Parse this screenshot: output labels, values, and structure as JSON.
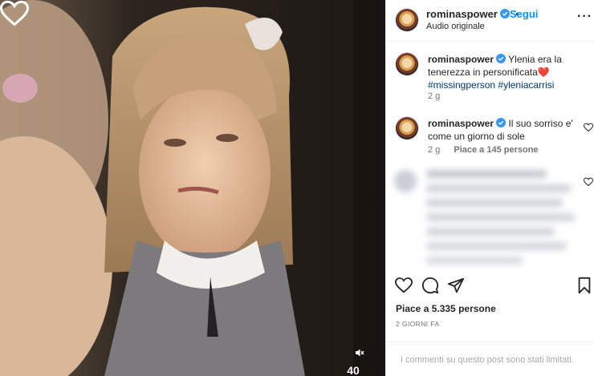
{
  "media": {
    "reel_like_count": "40",
    "heart_icon": "heart-outline-icon",
    "mute_icon": "speaker-muted-icon"
  },
  "post": {
    "author": "rominaspower",
    "follow_label": "Segui",
    "audio_label": "Audio originale",
    "more_icon": "more-horizontal-icon",
    "accent_color": "#0095f6",
    "verified_color": "#3897f0"
  },
  "caption": {
    "author": "rominaspower",
    "text": "Ylenia era la tenerezza in personificata",
    "emoji": "❤️",
    "hashtags": [
      "#missingperson",
      "#yleniacarrisi"
    ],
    "age": "2 g"
  },
  "comments": [
    {
      "author": "rominaspower",
      "text": "Il suo sorriso e' come un giorno di sole",
      "age": "2 g",
      "likes": "Piace a 145 persone"
    }
  ],
  "actions": {
    "like_icon": "heart-icon",
    "comment_icon": "comment-icon",
    "share_icon": "send-icon",
    "save_icon": "bookmark-icon"
  },
  "stats": {
    "likes": "Piace a 5.335 persone",
    "date": "2 GIORNI FA"
  },
  "footer": {
    "limited_comments": "I commenti su questo post sono stati limitati."
  }
}
